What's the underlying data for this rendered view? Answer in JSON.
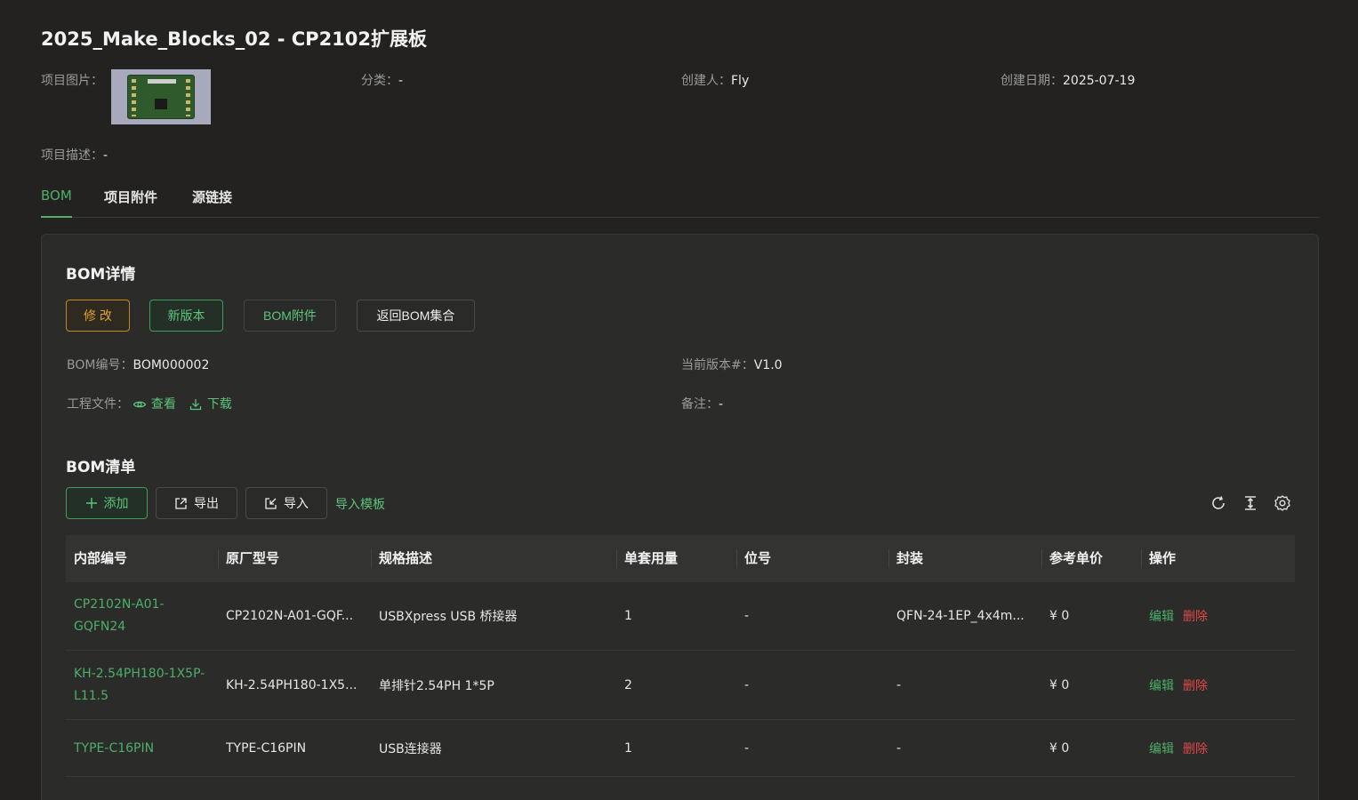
{
  "page": {
    "title": "2025_Make_Blocks_02 - CP2102扩展板"
  },
  "meta": {
    "image_label": "项目图片：",
    "category_label": "分类：",
    "category_value": "-",
    "creator_label": "创建人：",
    "creator_value": "Fly",
    "created_label": "创建日期：",
    "created_value": "2025-07-19",
    "desc_label": "项目描述：",
    "desc_value": "-"
  },
  "tabs": [
    {
      "label": "BOM"
    },
    {
      "label": "项目附件"
    },
    {
      "label": "源链接"
    }
  ],
  "bom_detail": {
    "title": "BOM详情",
    "buttons": {
      "edit": "修 改",
      "new_version": "新版本",
      "attachments": "BOM附件",
      "back": "返回BOM集合"
    },
    "bom_no_label": "BOM编号：",
    "bom_no_value": "BOM000002",
    "version_label": "当前版本#：",
    "version_value": "V1.0",
    "project_file_label": "工程文件：",
    "view_label": "查看",
    "download_label": "下载",
    "remark_label": "备注：",
    "remark_value": "-"
  },
  "bom_list": {
    "title": "BOM清单",
    "buttons": {
      "add": "添加",
      "export": "导出",
      "import": "导入",
      "template": "导入模板"
    },
    "columns": [
      "内部编号",
      "原厂型号",
      "规格描述",
      "单套用量",
      "位号",
      "封装",
      "参考单价",
      "操作"
    ],
    "rows": [
      {
        "code": "CP2102N-A01-GQFN24",
        "mpn": "CP2102N-A01-GQF...",
        "spec": "USBXpress USB 桥接器",
        "qty": "1",
        "ref": "-",
        "pkg": "QFN-24-1EP_4x4m...",
        "price": "¥ 0",
        "edit": "编辑",
        "delete": "删除"
      },
      {
        "code": "KH-2.54PH180-1X5P-L11.5",
        "mpn": "KH-2.54PH180-1X5...",
        "spec": "单排针2.54PH 1*5P",
        "qty": "2",
        "ref": "-",
        "pkg": "-",
        "price": "¥ 0",
        "edit": "编辑",
        "delete": "删除"
      },
      {
        "code": "TYPE-C16PIN",
        "mpn": "TYPE-C16PIN",
        "spec": "USB连接器",
        "qty": "1",
        "ref": "-",
        "pkg": "-",
        "price": "¥ 0",
        "edit": "编辑",
        "delete": "删除"
      }
    ]
  },
  "icons": {
    "refresh": "refresh-icon",
    "column_height": "column-height-icon",
    "settings": "gear-icon"
  },
  "colors": {
    "accent": "#4caf6a",
    "warning": "#e0a030",
    "danger": "#e04848",
    "background": "#232220"
  }
}
